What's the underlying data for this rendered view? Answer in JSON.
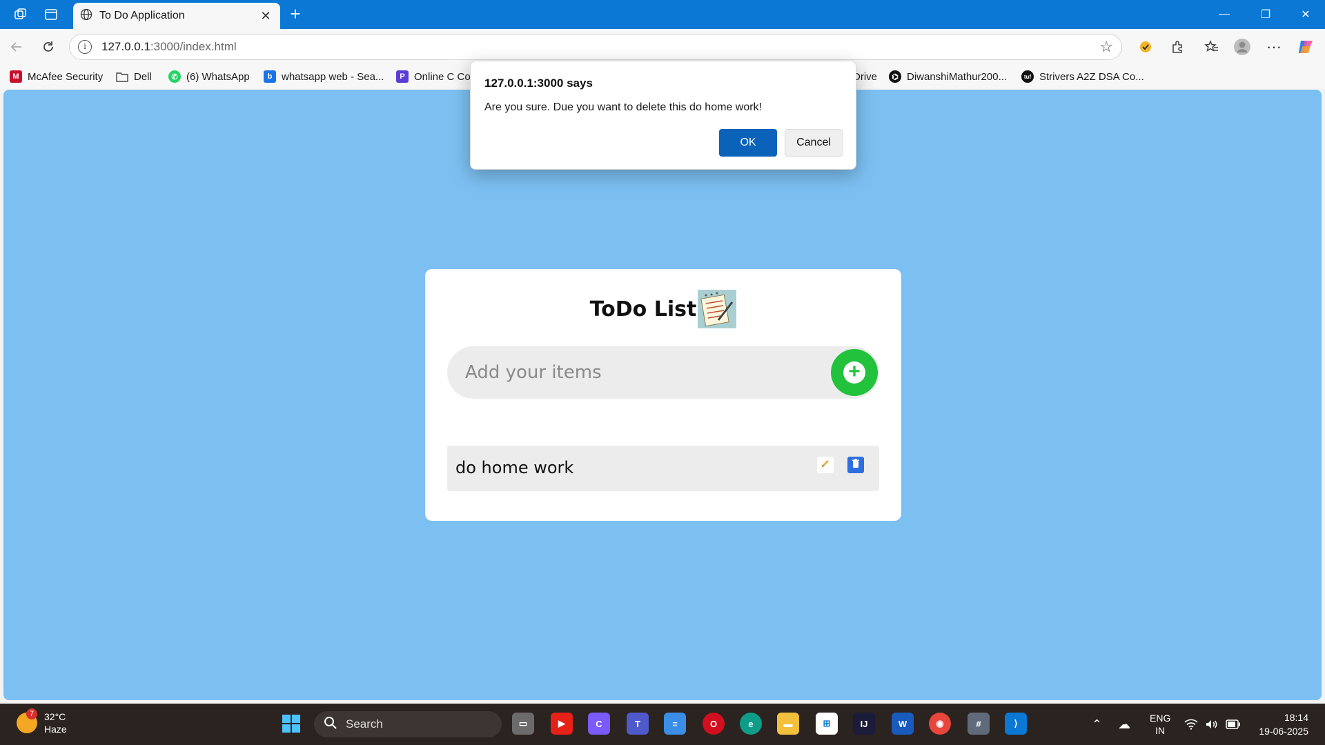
{
  "browser": {
    "tab_title": "To Do Application",
    "url_host": "127.0.0.1",
    "url_rest": ":3000/index.html",
    "bookmarks": [
      "McAfee Security",
      "Dell",
      "(6) WhatsApp",
      "whatsapp web - Sea...",
      "Online C Co",
      "Drive",
      "DiwanshiMathur200...",
      "Strivers A2Z DSA Co..."
    ]
  },
  "app": {
    "title": "ToDo List",
    "input_placeholder": "Add your items",
    "items": [
      {
        "text": "do home work"
      }
    ]
  },
  "dialog": {
    "title": "127.0.0.1:3000 says",
    "message": "Are you sure. Due you want to delete this do home work!",
    "ok_label": "OK",
    "cancel_label": "Cancel"
  },
  "taskbar": {
    "weather_badge": "7",
    "temperature": "32°C",
    "condition": "Haze",
    "search_placeholder": "Search",
    "language": "ENG",
    "region": "IN",
    "time": "18:14",
    "date": "19-06-2025"
  },
  "colors": {
    "accent": "#0a78d4",
    "page_background": "#7cc0f2",
    "add_button": "#22c23c",
    "delete_button": "#2f6fe0",
    "dialog_ok": "#0a63b8"
  }
}
